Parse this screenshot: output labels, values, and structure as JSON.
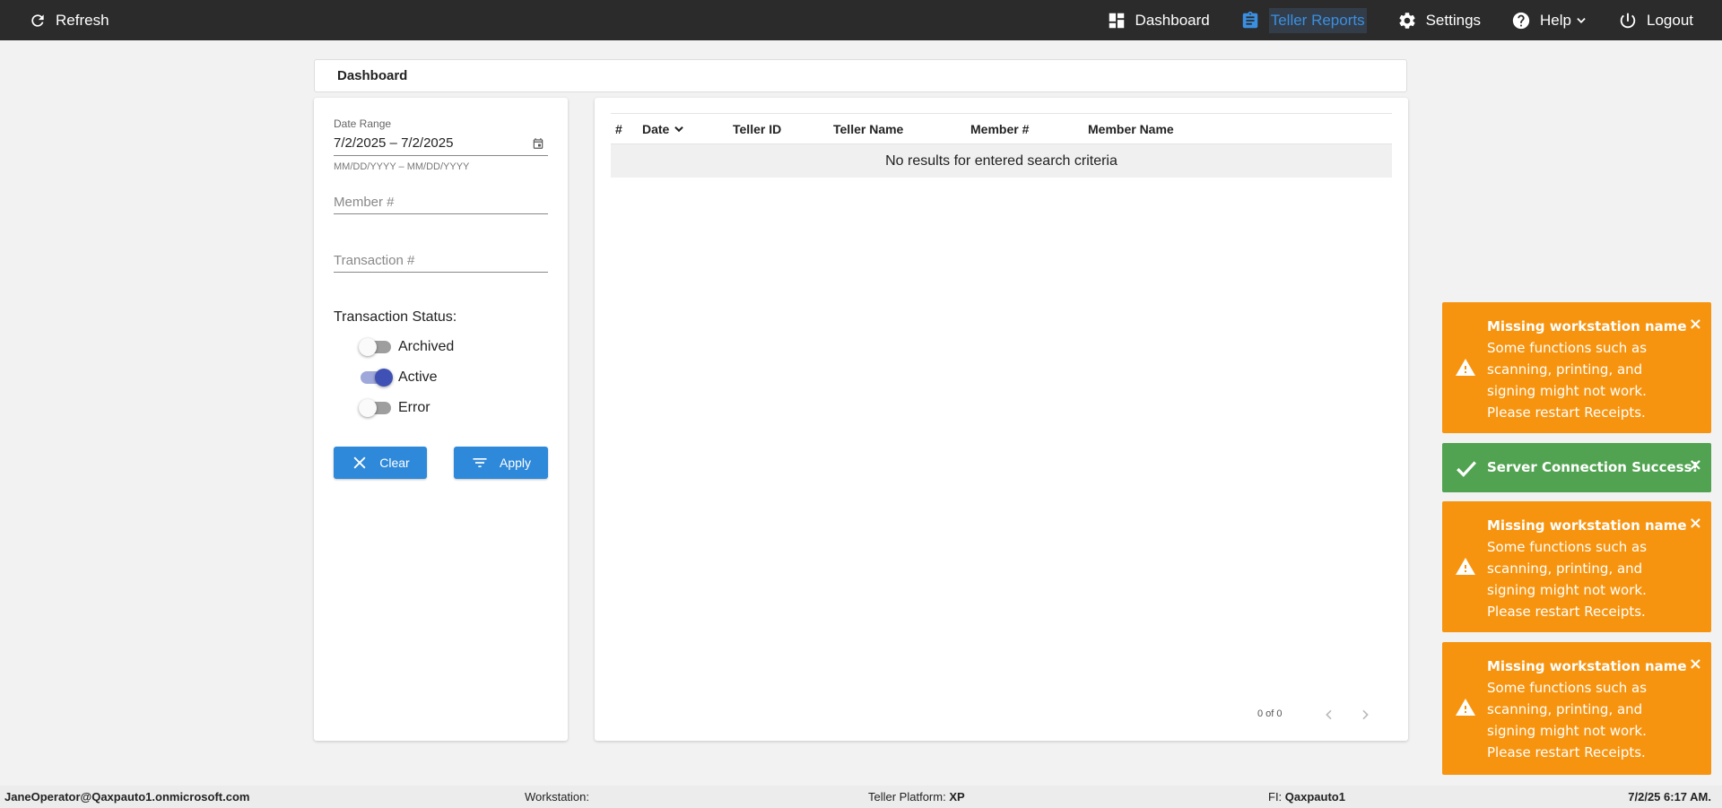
{
  "topbar": {
    "refresh_label": "Refresh",
    "nav": [
      {
        "label": "Dashboard",
        "icon": "dashboard-icon"
      },
      {
        "label": "Teller Reports",
        "icon": "clipboard-icon",
        "active": true
      },
      {
        "label": "Settings",
        "icon": "gear-icon"
      },
      {
        "label": "Help",
        "icon": "help-icon"
      },
      {
        "label": "Logout",
        "icon": "power-icon"
      }
    ]
  },
  "page_title": "Dashboard",
  "filters": {
    "date_range_label": "Date Range",
    "date_range_value": "7/2/2025 – 7/2/2025",
    "date_range_hint": "MM/DD/YYYY – MM/DD/YYYY",
    "member_placeholder": "Member #",
    "transaction_placeholder": "Transaction #",
    "status_title": "Transaction Status:",
    "statuses": [
      {
        "label": "Archived",
        "on": false
      },
      {
        "label": "Active",
        "on": true
      },
      {
        "label": "Error",
        "on": false
      }
    ],
    "clear_label": "Clear",
    "apply_label": "Apply"
  },
  "table": {
    "columns": [
      "#",
      "Date",
      "Teller ID",
      "Teller Name",
      "Member #",
      "Member Name"
    ],
    "empty_message": "No results for entered search criteria",
    "pager_count": "0 of 0"
  },
  "toasts": [
    {
      "type": "warning",
      "title": "Missing workstation name",
      "body": "Some functions such as scanning, printing, and signing might not work. Please restart Receipts."
    },
    {
      "type": "success",
      "title": "Server Connection Success!",
      "body": ""
    },
    {
      "type": "warning",
      "title": "Missing workstation name",
      "body": "Some functions such as scanning, printing, and signing might not work. Please restart Receipts."
    },
    {
      "type": "warning",
      "title": "Missing workstation name",
      "body": "Some functions such as scanning, printing, and signing might not work. Please restart Receipts."
    }
  ],
  "toast_close": "×",
  "footer": {
    "user": "JaneOperator@Qaxpauto1.onmicrosoft.com",
    "workstation_label": "Workstation:",
    "workstation_value": "",
    "platform_label": "Teller Platform:",
    "platform_value": "XP",
    "fi_label": "FI:",
    "fi_value": "Qaxpauto1",
    "datetime": "7/2/25 6:17 AM."
  },
  "colors": {
    "topbar": "#2b2b2b",
    "accent": "#3b8fe0",
    "button": "#2e89da",
    "warning": "#f7940f",
    "success": "#51a351",
    "toggle_on": "#3f51b5"
  }
}
